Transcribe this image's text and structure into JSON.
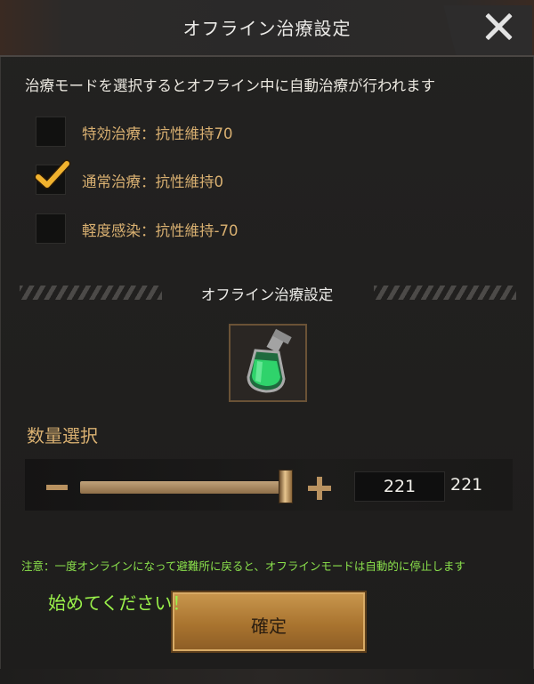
{
  "header": {
    "title": "オフライン治療設定"
  },
  "instruction": "治療モードを選択するとオフライン中に自動治療が行われます",
  "options": [
    {
      "label": "特効治療：抗性維持70",
      "checked": false
    },
    {
      "label": "通常治療：抗性維持0",
      "checked": true
    },
    {
      "label": "軽度感染：抗性維持-70",
      "checked": false
    }
  ],
  "section": {
    "title": "オフライン治療設定"
  },
  "item": {
    "icon": "green-medicine-bottle-icon"
  },
  "quantity": {
    "title": "数量選択",
    "value": "221",
    "max": "221",
    "fill_fraction": 1.0
  },
  "notice": "注意：一度オンラインになって避難所に戻ると、オフラインモードは自動的に停止します",
  "start_message": "始めてください！",
  "confirm_button": {
    "label": "確定"
  },
  "colors": {
    "accent_gold": "#d9b071",
    "notice_green": "#8be24c",
    "button_gold": "#c9974e"
  }
}
